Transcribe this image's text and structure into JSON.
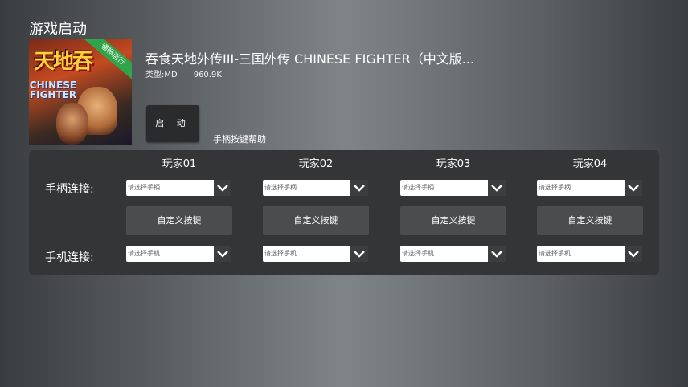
{
  "page": {
    "title": "游戏启动"
  },
  "game": {
    "cover_badge": "通畅运行",
    "cover_logo_text": "天地吞",
    "cover_logo_subtitle": "CHINESE FIGHTER",
    "title": "吞食天地外传III-三国外传 CHINESE FIGHTER（中文版...",
    "type_label": "类型:MD",
    "size": "960.9K"
  },
  "actions": {
    "launch_label": "启 动",
    "help_label": "手柄按键帮助"
  },
  "players": [
    {
      "label": "玩家01",
      "gamepad_placeholder": "请选择手柄",
      "keymap_label": "自定义按键",
      "phone_placeholder": "请选择手机"
    },
    {
      "label": "玩家02",
      "gamepad_placeholder": "请选择手柄",
      "keymap_label": "自定义按键",
      "phone_placeholder": "请选择手机"
    },
    {
      "label": "玩家03",
      "gamepad_placeholder": "请选择手柄",
      "keymap_label": "自定义按键",
      "phone_placeholder": "请选择手机"
    },
    {
      "label": "玩家04",
      "gamepad_placeholder": "请选择手柄",
      "keymap_label": "自定义按键",
      "phone_placeholder": "请选择手机"
    }
  ],
  "rows": {
    "gamepad_label": "手柄连接:",
    "phone_label": "手机连接:"
  },
  "colors": {
    "panel": "#333536",
    "badge": "#2fa44a",
    "button": "#2a2b2c"
  }
}
